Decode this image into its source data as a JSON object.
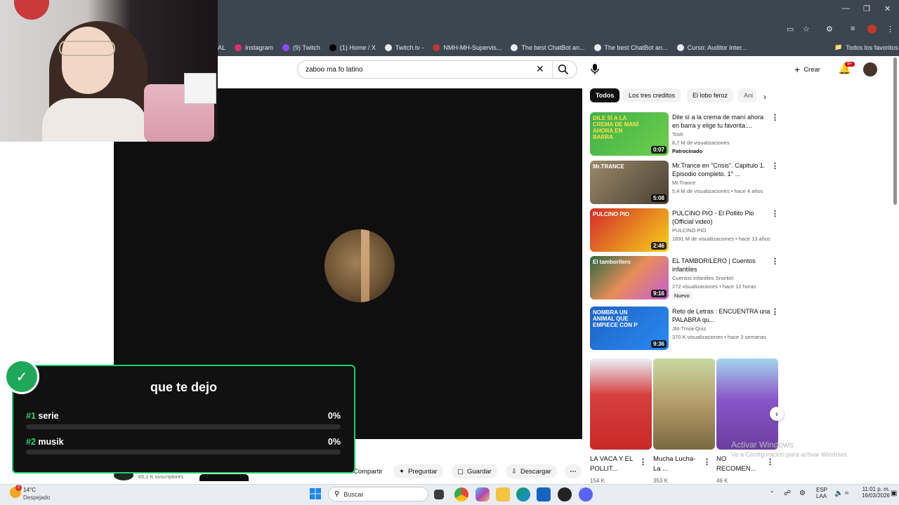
{
  "browser": {
    "bookmarks": [
      {
        "label": "AL",
        "color": "#9aa0a6"
      },
      {
        "label": "Instagram",
        "color": "#e1306c"
      },
      {
        "label": "(9) Twitch",
        "color": "#9146ff"
      },
      {
        "label": "(1) Home / X",
        "color": "#000000"
      },
      {
        "label": "Twitch.tv -",
        "color": "#e8eaed"
      },
      {
        "label": "NMH-MH-Supervis...",
        "color": "#c0392b"
      },
      {
        "label": "The best ChatBot an...",
        "color": "#e8eaed"
      },
      {
        "label": "The best ChatBot an...",
        "color": "#e8eaed"
      },
      {
        "label": "Curso: Auditor Inter...",
        "color": "#e8eaed"
      }
    ],
    "all_favorites": "Todos los favoritos"
  },
  "youtube": {
    "search_value": "zaboo ma fo latino",
    "create_label": "Crear",
    "notif_count": "9+",
    "chips": [
      "Todos",
      "Los tres creditos",
      "El lobo feroz",
      "Ani"
    ],
    "videos": [
      {
        "title": "Dile sí a la crema de maní ahora en barra y elige tu favorita:...",
        "channel": "Tosh",
        "meta": "8,7 M de visualizaciones",
        "badge": "Patrocinado",
        "duration": "0:07",
        "thumb_text": "DILE SÍ A LA CREMA DE MANÍ AHORA EN BARRA"
      },
      {
        "title": "Mr.Trance en \"Crisis\". Capitulo 1. Episodio completo. 1° ...",
        "channel": "Mr.Trance",
        "meta": "5,4 M de visualizaciones • hace 4 años",
        "badge": "",
        "duration": "5:08",
        "thumb_text": "Mr.TRANCE"
      },
      {
        "title": "PULCINO PIO - El Pollito Pio (Official video)",
        "channel": "PULCINO PIO",
        "meta": "1691 M de visualizaciones • hace 13 años",
        "badge": "",
        "duration": "2:46",
        "thumb_text": "PULCINO PIO"
      },
      {
        "title": "EL TAMBORILERO | Cuentos infantiles",
        "channel": "Cuentos infantiles Snorkel",
        "meta": "272 visualizaciones • hace 12 horas",
        "badge": "Nuevo",
        "duration": "9:16",
        "thumb_text": "El tamborilero"
      },
      {
        "title": "Reto de Letras : ENCUENTRA una PALABRA qu...",
        "channel": "JM-Trivia-Quiz",
        "meta": "370 K visualizaciones • hace 3 semanas",
        "badge": "",
        "duration": "9:36",
        "thumb_text": "NOMBRA UN ANIMAL QUE EMPIECE CON P"
      }
    ],
    "shorts": [
      {
        "title": "LA VACA Y EL POLLIT...",
        "views": "154 K"
      },
      {
        "title": "Mucha Lucha- La ...",
        "views": "353 K"
      },
      {
        "title": "NO RECOMEN...",
        "views": "46 K"
      }
    ],
    "actions": {
      "share": "Compartir",
      "ask": "Preguntar",
      "save": "Guardar",
      "download": "Descargar"
    },
    "subscribers": "65,1 K suscriptores"
  },
  "poll": {
    "title": "que te dejo",
    "options": [
      {
        "num": "#1",
        "label": "serie",
        "pct": "0%"
      },
      {
        "num": "#2",
        "label": "musik",
        "pct": "0%"
      }
    ]
  },
  "windows": {
    "watermark_1": "Activar Windows",
    "watermark_2": "Ve a Configuración para activar Windows.",
    "weather_temp": "14°C",
    "weather_desc": "Despejado",
    "search_label": "Buscar",
    "lang_1": "ESP",
    "lang_2": "LAA",
    "time": "11:01 p. m.",
    "date": "16/03/2026"
  }
}
